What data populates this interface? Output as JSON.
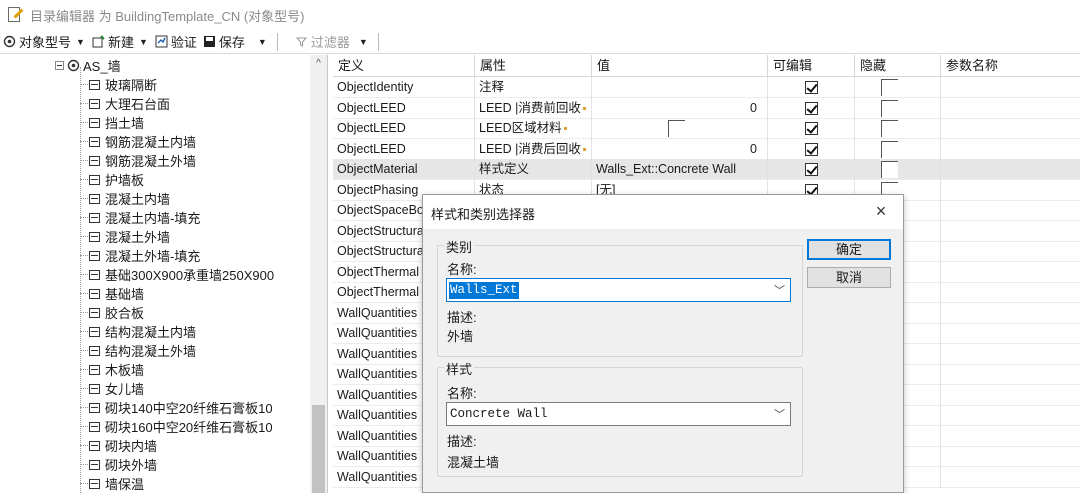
{
  "window": {
    "title": "目录编辑器 为 BuildingTemplate_CN (对象型号)"
  },
  "toolbar": {
    "object_type_label": "对象型号",
    "new_label": "新建",
    "validate_label": "验证",
    "save_label": "保存",
    "filter_label": "过滤器"
  },
  "tree": {
    "root_label": "AS_墙",
    "items": [
      "玻璃隔断",
      "大理石台面",
      "挡土墙",
      "钢筋混凝土内墙",
      "钢筋混凝土外墙",
      "护墙板",
      "混凝土内墙",
      "混凝土内墙-填充",
      "混凝土外墙",
      "混凝土外墙-填充",
      "基础300X900承重墙250X900",
      "基础墙",
      "胶合板",
      "结构混凝土内墙",
      "结构混凝土外墙",
      "木板墙",
      "女儿墙",
      "砌块140中空20纤维石膏板10",
      "砌块160中空20纤维石膏板10",
      "砌块内墙",
      "砌块外墙",
      "墙保温"
    ]
  },
  "grid": {
    "columns": [
      "定义",
      "属性",
      "值",
      "可编辑",
      "隐藏",
      "参数名称"
    ],
    "rows": [
      {
        "definition": "ObjectIdentity",
        "property": "注释",
        "value": "",
        "editable": true,
        "hidden": false
      },
      {
        "definition": "ObjectLEED",
        "property": "LEED |消费前回收",
        "value": "0",
        "editable": true,
        "hidden": false
      },
      {
        "definition": "ObjectLEED",
        "property": "LEED区域材料",
        "value": "",
        "editable": true,
        "hidden": false
      },
      {
        "definition": "ObjectLEED",
        "property": "LEED |消费后回收",
        "value": "0",
        "editable": true,
        "hidden": false
      },
      {
        "definition": "ObjectMaterial",
        "property": "样式定义",
        "value": "Walls_Ext::Concrete Wall",
        "editable": true,
        "hidden": false
      },
      {
        "definition": "ObjectPhasing",
        "property": "状态",
        "value": "[无]",
        "editable": true,
        "hidden": false
      },
      {
        "definition": "ObjectSpaceBo",
        "property": "",
        "value": "",
        "editable": true,
        "hidden": false
      },
      {
        "definition": "ObjectStructura",
        "property": "",
        "value": "",
        "editable": true,
        "hidden": false
      },
      {
        "definition": "ObjectStructura",
        "property": "",
        "value": "",
        "editable": true,
        "hidden": false
      },
      {
        "definition": "ObjectThermal",
        "property": "",
        "value": "",
        "editable": true,
        "hidden": false
      },
      {
        "definition": "ObjectThermal",
        "property": "",
        "value": "",
        "editable": true,
        "hidden": false
      },
      {
        "definition": "WallQuantities",
        "property": "",
        "value": "",
        "editable": true,
        "hidden": false
      },
      {
        "definition": "WallQuantities",
        "property": "",
        "value": "",
        "editable": true,
        "hidden": false
      },
      {
        "definition": "WallQuantities",
        "property": "",
        "value": "",
        "editable": true,
        "hidden": false
      },
      {
        "definition": "WallQuantities",
        "property": "",
        "value": "",
        "editable": true,
        "hidden": false
      },
      {
        "definition": "WallQuantities",
        "property": "",
        "value": "",
        "editable": true,
        "hidden": false
      },
      {
        "definition": "WallQuantities",
        "property": "",
        "value": "",
        "editable": true,
        "hidden": false
      },
      {
        "definition": "WallQuantities",
        "property": "",
        "value": "",
        "editable": true,
        "hidden": false
      },
      {
        "definition": "WallQuantities",
        "property": "",
        "value": "",
        "editable": true,
        "hidden": false
      },
      {
        "definition": "WallQuantities",
        "property": "",
        "value": "",
        "editable": true,
        "hidden": false
      }
    ]
  },
  "dialog": {
    "title": "样式和类别选择器",
    "close_glyph": "×",
    "category": {
      "group_label": "类别",
      "name_label": "名称:",
      "name_value": "Walls_Ext",
      "desc_label": "描述:",
      "desc_value": "外墙"
    },
    "style": {
      "group_label": "样式",
      "name_label": "名称:",
      "name_value": "Concrete Wall",
      "desc_label": "描述:",
      "desc_value": "混凝土墙"
    },
    "ok_label": "确定",
    "cancel_label": "取消"
  },
  "colors": {
    "accent": "#0078d7",
    "selected_row": "#e6e6e6",
    "dialog_bg": "#f0f0f0"
  }
}
